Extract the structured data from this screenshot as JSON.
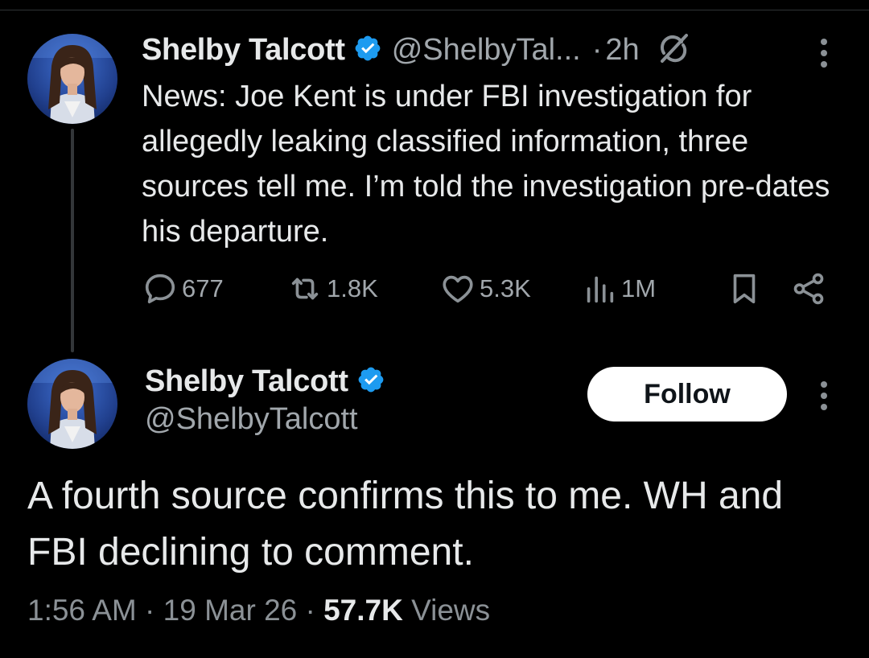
{
  "tweet_parent": {
    "author_name": "Shelby Talcott",
    "handle": "@ShelbyTal...",
    "separator": "·",
    "time": "2h",
    "text": "News: Joe Kent is under FBI investigation for allegedly leaking classified information, three sources tell me. I’m told the investigation pre-dates his departure.",
    "actions": {
      "replies": "677",
      "reposts": "1.8K",
      "likes": "5.3K",
      "views": "1M"
    }
  },
  "tweet_main": {
    "author_name": "Shelby Talcott",
    "handle": "@ShelbyTalcott",
    "follow_label": "Follow",
    "text": "A fourth source confirms this to me. WH and FBI declining to comment.",
    "timestamp": "1:56 AM · 19 Mar 26 · ",
    "views_count": "57.7K",
    "views_label": " Views"
  },
  "colors": {
    "background": "#000000",
    "text_primary": "#e7e9ea",
    "text_secondary": "#71767b",
    "verified_badge": "#1d9bf0",
    "follow_button_bg": "#ffffff"
  },
  "icons": {
    "verified": "verified-badge-icon",
    "grok": "grok-icon",
    "more": "more-vertical-icon",
    "reply": "reply-icon",
    "repost": "repost-icon",
    "like": "heart-icon",
    "views": "views-icon",
    "bookmark": "bookmark-icon",
    "share": "share-icon"
  }
}
